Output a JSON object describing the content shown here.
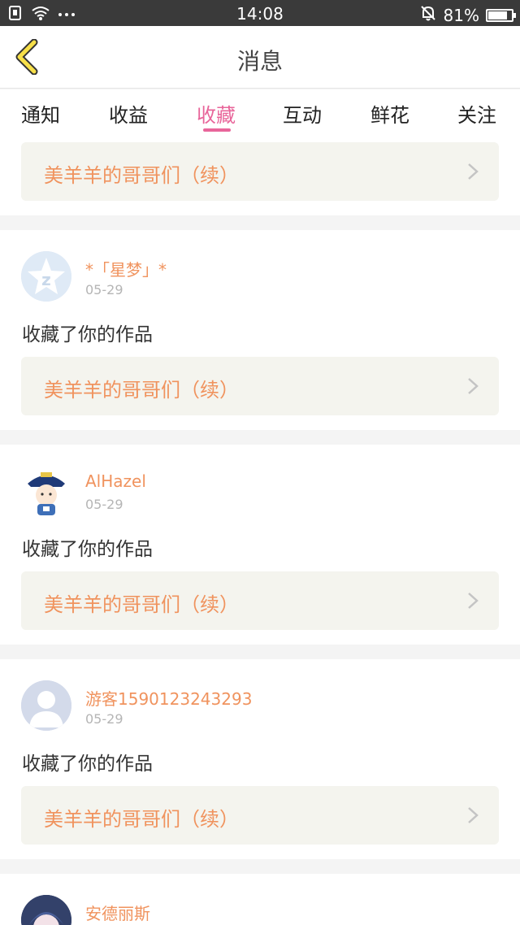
{
  "statusbar": {
    "time": "14:08",
    "battery": "81%",
    "battery_level": 0.81
  },
  "header": {
    "title": "消息"
  },
  "tabs": [
    {
      "label": "通知",
      "active": false
    },
    {
      "label": "收益",
      "active": false
    },
    {
      "label": "收藏",
      "active": true
    },
    {
      "label": "互动",
      "active": false
    },
    {
      "label": "鲜花",
      "active": false
    },
    {
      "label": "关注",
      "active": false
    }
  ],
  "top_work": {
    "title": "美羊羊的哥哥们（续）"
  },
  "messages": [
    {
      "user": "*「星梦」*",
      "date": "05-29",
      "action": "收藏了你的作品",
      "work": "美羊羊的哥哥们（续）"
    },
    {
      "user": "AlHazel",
      "date": "05-29",
      "action": "收藏了你的作品",
      "work": "美羊羊的哥哥们（续）"
    },
    {
      "user": "游客1590123243293",
      "date": "05-29",
      "action": "收藏了你的作品",
      "work": "美羊羊的哥哥们（续）"
    },
    {
      "user": "安德丽斯"
    }
  ]
}
